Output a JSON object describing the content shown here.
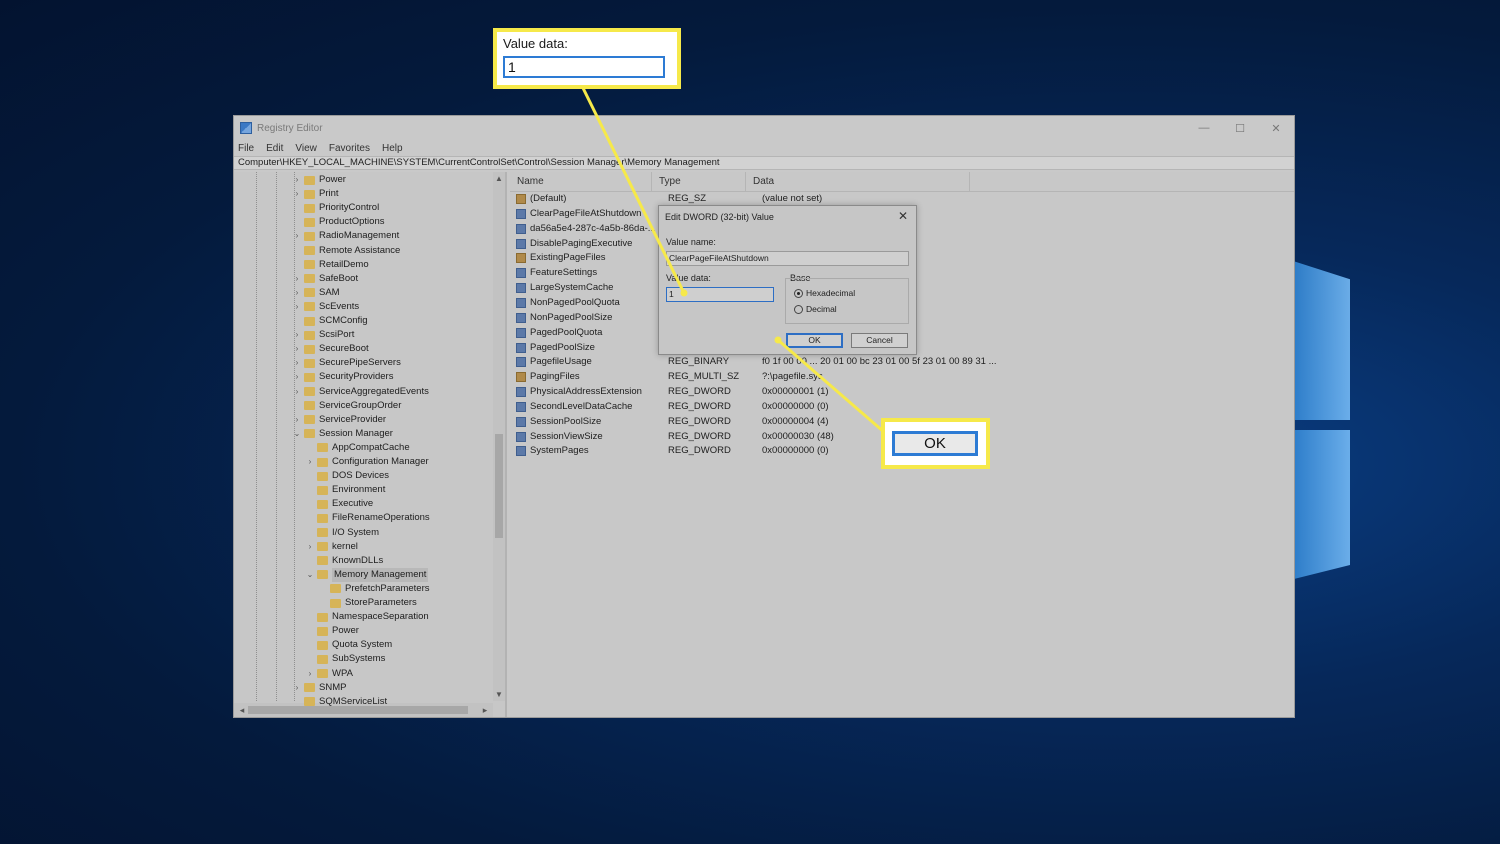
{
  "window": {
    "title": "Registry Editor",
    "controls": {
      "minimize": "—",
      "maximize": "☐",
      "close": "✕"
    },
    "menu": [
      "File",
      "Edit",
      "View",
      "Favorites",
      "Help"
    ],
    "address": "Computer\\HKEY_LOCAL_MACHINE\\SYSTEM\\CurrentControlSet\\Control\\Session Manager\\Memory Management"
  },
  "tree": {
    "items": [
      {
        "label": "Power",
        "depth": 0,
        "chevron": "›"
      },
      {
        "label": "Print",
        "depth": 0,
        "chevron": "›"
      },
      {
        "label": "PriorityControl",
        "depth": 0,
        "chevron": ""
      },
      {
        "label": "ProductOptions",
        "depth": 0,
        "chevron": ""
      },
      {
        "label": "RadioManagement",
        "depth": 0,
        "chevron": "›"
      },
      {
        "label": "Remote Assistance",
        "depth": 0,
        "chevron": ""
      },
      {
        "label": "RetailDemo",
        "depth": 0,
        "chevron": ""
      },
      {
        "label": "SafeBoot",
        "depth": 0,
        "chevron": "›"
      },
      {
        "label": "SAM",
        "depth": 0,
        "chevron": "›"
      },
      {
        "label": "ScEvents",
        "depth": 0,
        "chevron": "›"
      },
      {
        "label": "SCMConfig",
        "depth": 0,
        "chevron": ""
      },
      {
        "label": "ScsiPort",
        "depth": 0,
        "chevron": "›"
      },
      {
        "label": "SecureBoot",
        "depth": 0,
        "chevron": "›"
      },
      {
        "label": "SecurePipeServers",
        "depth": 0,
        "chevron": "›"
      },
      {
        "label": "SecurityProviders",
        "depth": 0,
        "chevron": "›"
      },
      {
        "label": "ServiceAggregatedEvents",
        "depth": 0,
        "chevron": "›"
      },
      {
        "label": "ServiceGroupOrder",
        "depth": 0,
        "chevron": ""
      },
      {
        "label": "ServiceProvider",
        "depth": 0,
        "chevron": "›"
      },
      {
        "label": "Session Manager",
        "depth": 0,
        "chevron": "⌄"
      },
      {
        "label": "AppCompatCache",
        "depth": 1,
        "chevron": ""
      },
      {
        "label": "Configuration Manager",
        "depth": 1,
        "chevron": "›"
      },
      {
        "label": "DOS Devices",
        "depth": 1,
        "chevron": ""
      },
      {
        "label": "Environment",
        "depth": 1,
        "chevron": ""
      },
      {
        "label": "Executive",
        "depth": 1,
        "chevron": ""
      },
      {
        "label": "FileRenameOperations",
        "depth": 1,
        "chevron": ""
      },
      {
        "label": "I/O System",
        "depth": 1,
        "chevron": ""
      },
      {
        "label": "kernel",
        "depth": 1,
        "chevron": "›"
      },
      {
        "label": "KnownDLLs",
        "depth": 1,
        "chevron": ""
      },
      {
        "label": "Memory Management",
        "depth": 1,
        "chevron": "⌄",
        "selected": true
      },
      {
        "label": "PrefetchParameters",
        "depth": 2,
        "chevron": ""
      },
      {
        "label": "StoreParameters",
        "depth": 2,
        "chevron": ""
      },
      {
        "label": "NamespaceSeparation",
        "depth": 1,
        "chevron": ""
      },
      {
        "label": "Power",
        "depth": 1,
        "chevron": ""
      },
      {
        "label": "Quota System",
        "depth": 1,
        "chevron": ""
      },
      {
        "label": "SubSystems",
        "depth": 1,
        "chevron": ""
      },
      {
        "label": "WPA",
        "depth": 1,
        "chevron": "›"
      },
      {
        "label": "SNMP",
        "depth": 0,
        "chevron": "›"
      },
      {
        "label": "SQMServiceList",
        "depth": 0,
        "chevron": ""
      }
    ]
  },
  "list": {
    "columns": [
      "Name",
      "Type",
      "Data"
    ],
    "rows": [
      {
        "name": "(Default)",
        "type": "REG_SZ",
        "data": "(value not set)",
        "kind": "sz"
      },
      {
        "name": "ClearPageFileAtShutdown",
        "type": "",
        "data": "",
        "kind": "dword"
      },
      {
        "name": "da56a5e4-287c-4a5b-86da-...",
        "type": "",
        "data": "",
        "kind": "dword"
      },
      {
        "name": "DisablePagingExecutive",
        "type": "",
        "data": "",
        "kind": "dword"
      },
      {
        "name": "ExistingPageFiles",
        "type": "",
        "data": "",
        "kind": "sz"
      },
      {
        "name": "FeatureSettings",
        "type": "",
        "data": "",
        "kind": "dword"
      },
      {
        "name": "LargeSystemCache",
        "type": "",
        "data": "",
        "kind": "dword"
      },
      {
        "name": "NonPagedPoolQuota",
        "type": "",
        "data": "",
        "kind": "dword"
      },
      {
        "name": "NonPagedPoolSize",
        "type": "",
        "data": "",
        "kind": "dword"
      },
      {
        "name": "PagedPoolQuota",
        "type": "",
        "data": "",
        "kind": "dword"
      },
      {
        "name": "PagedPoolSize",
        "type": "",
        "data": "",
        "kind": "dword"
      },
      {
        "name": "PagefileUsage",
        "type": "REG_BINARY",
        "data": "f0 1f 00 00 ... 20 01 00 bc 23 01 00 5f 23 01 00 89 31 ...",
        "kind": "dword"
      },
      {
        "name": "PagingFiles",
        "type": "REG_MULTI_SZ",
        "data": "?:\\pagefile.sys",
        "kind": "sz"
      },
      {
        "name": "PhysicalAddressExtension",
        "type": "REG_DWORD",
        "data": "0x00000001 (1)",
        "kind": "dword"
      },
      {
        "name": "SecondLevelDataCache",
        "type": "REG_DWORD",
        "data": "0x00000000 (0)",
        "kind": "dword"
      },
      {
        "name": "SessionPoolSize",
        "type": "REG_DWORD",
        "data": "0x00000004 (4)",
        "kind": "dword"
      },
      {
        "name": "SessionViewSize",
        "type": "REG_DWORD",
        "data": "0x00000030 (48)",
        "kind": "dword"
      },
      {
        "name": "SystemPages",
        "type": "REG_DWORD",
        "data": "0x00000000 (0)",
        "kind": "dword"
      }
    ]
  },
  "dialog": {
    "title": "Edit DWORD (32-bit) Value",
    "close": "✕",
    "value_name_label": "Value name:",
    "value_name": "ClearPageFileAtShutdown",
    "value_data_label": "Value data:",
    "value_data": "1",
    "base_label": "Base",
    "hex_label": "Hexadecimal",
    "dec_label": "Decimal",
    "ok_label": "OK",
    "cancel_label": "Cancel"
  },
  "callouts": {
    "value_data_label": "Value data:",
    "value_data": "1",
    "ok_label": "OK"
  },
  "colors": {
    "highlight": "#f6e94a",
    "focus": "#2d7bd4",
    "desktop": "#06285a"
  }
}
